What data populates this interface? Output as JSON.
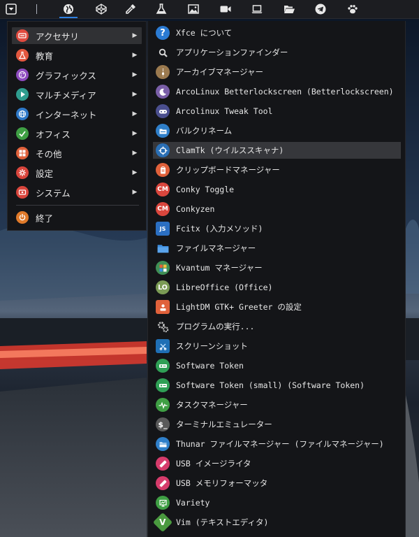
{
  "panel": {
    "buttons": [
      {
        "name": "menu-button",
        "icon": "down-arrow-square-icon"
      },
      {
        "name": "web-browser-launcher",
        "icon": "globe-icon"
      },
      {
        "name": "codepen-launcher",
        "icon": "cube-outline-icon"
      },
      {
        "name": "color-picker-launcher",
        "icon": "eyedropper-icon"
      },
      {
        "name": "science-launcher",
        "icon": "flask-icon"
      },
      {
        "name": "image-viewer-launcher",
        "icon": "picture-icon"
      },
      {
        "name": "video-launcher",
        "icon": "video-camera-icon"
      },
      {
        "name": "laptop-launcher",
        "icon": "laptop-icon"
      },
      {
        "name": "file-manager-launcher",
        "icon": "folder-open-icon"
      },
      {
        "name": "telegram-launcher",
        "icon": "paper-plane-icon"
      },
      {
        "name": "paw-launcher",
        "icon": "paw-icon"
      }
    ]
  },
  "main_menu": {
    "categories": [
      {
        "label": "アクセサリ",
        "color": "#e04a3f",
        "icon": "accessories-icon"
      },
      {
        "label": "教育",
        "color": "#e2573f",
        "icon": "flask-icon"
      },
      {
        "label": "グラフィックス",
        "color": "#8d4bbf",
        "icon": "palette-icon"
      },
      {
        "label": "マルチメディア",
        "color": "#2f9d8f",
        "icon": "multimedia-icon"
      },
      {
        "label": "インターネット",
        "color": "#2f79c9",
        "icon": "globe-icon"
      },
      {
        "label": "オフィス",
        "color": "#3f9f44",
        "icon": "check-icon"
      },
      {
        "label": "その他",
        "color": "#e0613b",
        "icon": "grid-icon"
      },
      {
        "label": "設定",
        "color": "#d8453c",
        "icon": "gear-icon"
      },
      {
        "label": "システム",
        "color": "#d8453c",
        "icon": "system-icon"
      }
    ],
    "quit_label": "終了",
    "quit_color": "#e07a2a"
  },
  "sub_menu": {
    "items": [
      {
        "label": "Xfce について",
        "color": "#2b7bd3",
        "icon": "help-icon",
        "glyph": "?"
      },
      {
        "label": "アプリケーションファインダー",
        "color": "#141518",
        "icon": "search-icon",
        "glyph": ""
      },
      {
        "label": "アーカイブマネージャー",
        "color": "#9b7a4f",
        "icon": "archive-icon",
        "glyph": ""
      },
      {
        "label": "ArcoLinux Betterlockscreen (Betterlockscreen)",
        "color": "#7a5fa8",
        "icon": "lock-moon-icon",
        "glyph": ""
      },
      {
        "label": "Arcolinux Tweak Tool",
        "color": "#4b4f8f",
        "icon": "gamepad-icon",
        "glyph": ""
      },
      {
        "label": "バルクリネーム",
        "color": "#2f7fc9",
        "icon": "folder-rename-icon",
        "glyph": ""
      },
      {
        "label": "ClamTk (ウイルススキャナ)",
        "color": "#2a6fb5",
        "icon": "crosshair-icon",
        "glyph": ""
      },
      {
        "label": "クリップボードマネージャー",
        "color": "#e0613b",
        "icon": "clipboard-icon",
        "glyph": ""
      },
      {
        "label": "Conky Toggle",
        "color": "#d9463d",
        "icon": "conky-icon",
        "glyph": "CM"
      },
      {
        "label": "Conkyzen",
        "color": "#d9463d",
        "icon": "conky-icon",
        "glyph": "CM"
      },
      {
        "label": "Fcitx (入力メソッド)",
        "color": "#2b6fc2",
        "icon": "keyboard-icon",
        "glyph": "JS"
      },
      {
        "label": "ファイルマネージャー",
        "color": "#3d8ee0",
        "icon": "folder-icon",
        "glyph": ""
      },
      {
        "label": "Kvantum マネージャー",
        "color": "#3f8f55",
        "icon": "kvantum-icon",
        "glyph": ""
      },
      {
        "label": "LibreOffice (Office)",
        "color": "#7b9b55",
        "icon": "libreoffice-icon",
        "glyph": "LO"
      },
      {
        "label": "LightDM GTK+ Greeter の設定",
        "color": "#e0613b",
        "icon": "greeter-icon",
        "glyph": ""
      },
      {
        "label": "プログラムの実行...",
        "color": "#141518",
        "icon": "gears-icon",
        "glyph": ""
      },
      {
        "label": "スクリーンショット",
        "color": "#1f6fb5",
        "icon": "screenshot-icon",
        "glyph": ""
      },
      {
        "label": "Software Token",
        "color": "#2f9f55",
        "icon": "token-icon",
        "glyph": ""
      },
      {
        "label": "Software Token (small) (Software Token)",
        "color": "#2f9f55",
        "icon": "token-icon",
        "glyph": ""
      },
      {
        "label": "タスクマネージャー",
        "color": "#3f9f44",
        "icon": "pulse-icon",
        "glyph": ""
      },
      {
        "label": "ターミナルエミュレーター",
        "color": "#5a5a5a",
        "icon": "terminal-icon",
        "glyph": "$"
      },
      {
        "label": "Thunar ファイルマネージャー (ファイルマネージャー)",
        "color": "#2f7fc9",
        "icon": "folder-icon",
        "glyph": ""
      },
      {
        "label": "USB イメージライタ",
        "color": "#d63b6b",
        "icon": "usb-icon",
        "glyph": ""
      },
      {
        "label": "USB メモリフォーマッタ",
        "color": "#d63b6b",
        "icon": "usb-icon",
        "glyph": ""
      },
      {
        "label": "Variety",
        "color": "#3f9f44",
        "icon": "variety-icon",
        "glyph": ""
      },
      {
        "label": "Vim (テキストエディタ)",
        "color": "#4a9a3f",
        "icon": "vim-icon",
        "glyph": "V"
      }
    ]
  }
}
